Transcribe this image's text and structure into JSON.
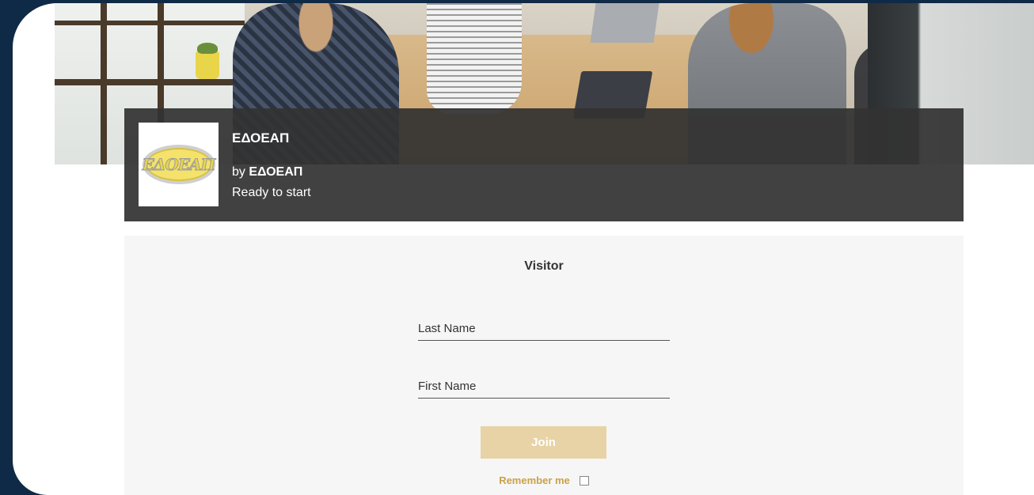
{
  "header": {
    "org_name": "ΕΔΟΕΑΠ",
    "by_prefix": "by",
    "by_name": "ΕΔΟΕΑΠ",
    "status": "Ready to start",
    "logo_text": "ΕΔΟΕΑΠ"
  },
  "form": {
    "title": "Visitor",
    "last_name_placeholder": "Last Name",
    "first_name_placeholder": "First Name",
    "join_label": "Join",
    "remember_label": "Remember me",
    "remember_checked": false
  },
  "colors": {
    "page_background": "#0f2a47",
    "overlay": "#333333",
    "join_button": "#e8d3a6",
    "accent_text": "#c9a24a",
    "panel_background": "#f6f6f6"
  },
  "icons": {
    "remember_checkbox": "checkbox-icon"
  }
}
